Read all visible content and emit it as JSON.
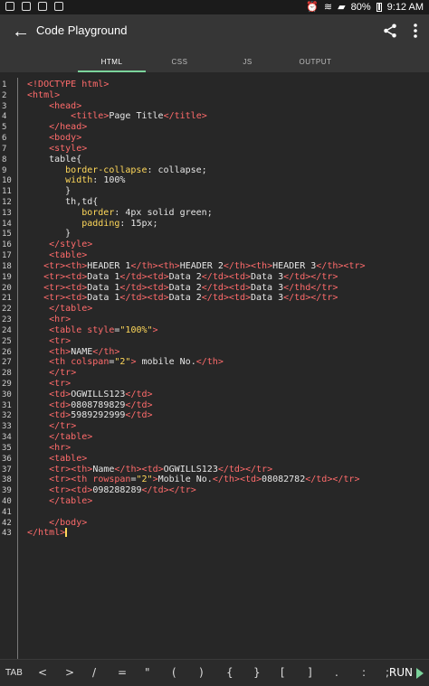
{
  "status": {
    "battery": "80%",
    "time": "9:12 AM"
  },
  "app": {
    "title": "Code Playground"
  },
  "tabs": [
    "HTML",
    "CSS",
    "JS",
    "OUTPUT"
  ],
  "toolbar_keys": [
    "TAB",
    "<",
    ">",
    "/",
    "=",
    "\"",
    "(",
    ")",
    "{",
    "}",
    "[",
    "]",
    ".",
    ":",
    ";",
    "RUN"
  ],
  "code_lines": [
    {
      "n": "1",
      "text": "<!DOCTYPE html>"
    },
    {
      "n": "2",
      "text": "<html>"
    },
    {
      "n": "3",
      "text": "    <head>"
    },
    {
      "n": "4",
      "text": "        <title>Page Title</title>"
    },
    {
      "n": "5",
      "text": "    </head>"
    },
    {
      "n": "6",
      "text": "    <body>"
    },
    {
      "n": "7",
      "text": "    <style>"
    },
    {
      "n": "8",
      "text": "    table{"
    },
    {
      "n": "9",
      "text": "       border-collapse: collapse;"
    },
    {
      "n": "10",
      "text": "       width: 100%"
    },
    {
      "n": "11",
      "text": "       }"
    },
    {
      "n": "12",
      "text": "       th,td{"
    },
    {
      "n": "13",
      "text": "          border: 4px solid green;"
    },
    {
      "n": "14",
      "text": "          padding: 15px;"
    },
    {
      "n": "15",
      "text": "       }"
    },
    {
      "n": "16",
      "text": "    </style>"
    },
    {
      "n": "17",
      "text": "    <table>"
    },
    {
      "n": "18",
      "text": "   <tr><th>HEADER 1</th><th>HEADER 2</th><th>HEADER 3</th><tr>"
    },
    {
      "n": "19",
      "text": "   <tr><td>Data 1</td><td>Data 2</td><td>Data 3</td></tr>"
    },
    {
      "n": "20",
      "text": "   <tr><td>Data 1</td><td>Data 2</td><td>Data 3</thd</tr>"
    },
    {
      "n": "21",
      "text": "   <tr><td>Data 1</td><td>Data 2</td><td>Data 3</td></tr>"
    },
    {
      "n": "22",
      "text": "    </table>"
    },
    {
      "n": "23",
      "text": "    <hr>"
    },
    {
      "n": "24",
      "text": "    <table style=\"100%\">"
    },
    {
      "n": "25",
      "text": "    <tr>"
    },
    {
      "n": "26",
      "text": "    <th>NAME</th>"
    },
    {
      "n": "27",
      "text": "    <th colspan=\"2\"> mobile No.</th>"
    },
    {
      "n": "28",
      "text": "    </tr>"
    },
    {
      "n": "29",
      "text": "    <tr>"
    },
    {
      "n": "30",
      "text": "    <td>OGWILLS123</td>"
    },
    {
      "n": "31",
      "text": "    <td>0808789829</td>"
    },
    {
      "n": "32",
      "text": "    <td>5989292999</td>"
    },
    {
      "n": "33",
      "text": "    </tr>"
    },
    {
      "n": "34",
      "text": "    </table>"
    },
    {
      "n": "35",
      "text": "    <hr>"
    },
    {
      "n": "36",
      "text": "    <table>"
    },
    {
      "n": "37",
      "text": "    <tr><th>Name</th><td>OGWILLS123</td></tr>"
    },
    {
      "n": "38",
      "text": "    <tr><th rowspan=\"2\">Mobile No.</th><td>08082782</td></tr>"
    },
    {
      "n": "39",
      "text": "    <tr><td>098288289</td></tr>"
    },
    {
      "n": "40",
      "text": "    </table>"
    },
    {
      "n": "41",
      "text": ""
    },
    {
      "n": "42",
      "text": "    </body>"
    },
    {
      "n": "43",
      "text": "</html>"
    }
  ]
}
